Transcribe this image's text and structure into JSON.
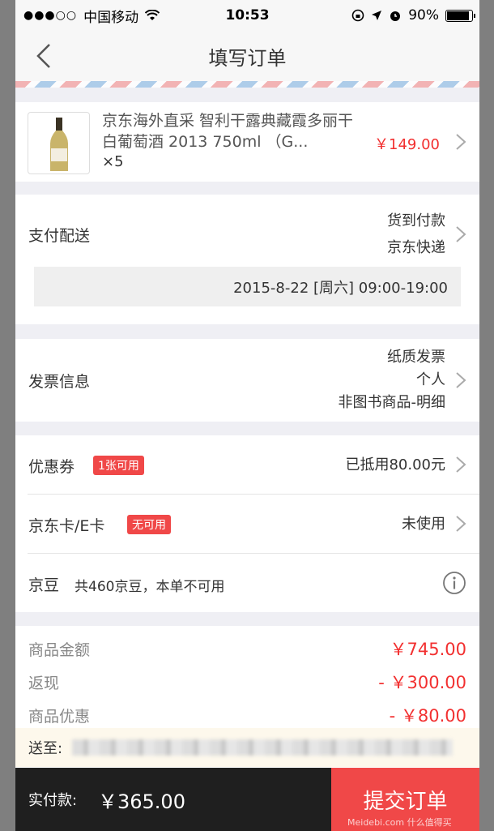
{
  "status_bar": {
    "carrier": "中国移动",
    "time": "10:53",
    "battery": "90%",
    "battery_level": 0.9
  },
  "nav": {
    "title": "填写订单"
  },
  "product": {
    "title": "京东海外直采 智利干露典藏霞多丽干白葡萄酒 2013 750ml （G...",
    "qty": "×5",
    "price": "￥149.00"
  },
  "payment": {
    "label": "支付配送",
    "method": "货到付款",
    "courier": "京东快递",
    "slot": "2015-8-22 [周六] 09:00-19:00"
  },
  "invoice": {
    "label": "发票信息",
    "type": "纸质发票",
    "title": "个人",
    "content": "非图书商品-明细"
  },
  "coupon": {
    "label": "优惠券",
    "badge": "1张可用",
    "value": "已抵用80.00元"
  },
  "jdcard": {
    "label": "京东卡/E卡",
    "badge": "无可用",
    "value": "未使用"
  },
  "jingdou": {
    "label": "京豆",
    "desc": "共460京豆，本单不可用"
  },
  "totals": {
    "goods_label": "商品金额",
    "goods_value": "￥745.00",
    "cashback_label": "返现",
    "cashback_value": "- ￥300.00",
    "discount_label": "商品优惠",
    "discount_value": "- ￥80.00"
  },
  "address": {
    "label": "送至:"
  },
  "footer": {
    "pay_label": "实付款:",
    "pay_total": "￥365.00",
    "submit": "提交订单",
    "watermark": "Meidebi.com 什么值得买"
  },
  "colors": {
    "accent": "#f04848",
    "price": "#f23030"
  }
}
